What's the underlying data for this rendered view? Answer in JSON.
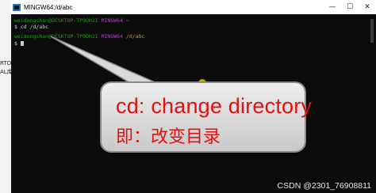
{
  "background_window": {
    "text_1": "RTOS",
    "text_2": "AL库实"
  },
  "window": {
    "title": "MINGW64:/d/abc",
    "icon": "mintty-terminal-icon",
    "controls": {
      "minimize": "—",
      "maximize": "☐",
      "close": "✕"
    }
  },
  "console": {
    "prompt1": {
      "user": "weidongshan@DESKTOP-TP9DH2I",
      "system": "MINGW64",
      "path": "~"
    },
    "command": "$ cd /d/abc",
    "prompt2": {
      "user": "weidongshan@DESKTOP-TP9DH2I",
      "system": "MINGW64",
      "path": "/d/abc"
    },
    "current_prompt": "$"
  },
  "callout": {
    "line1": "cd: change  directory",
    "line2": "即：改变目录",
    "text_color": "#e21010"
  },
  "watermark": "CSDN @2301_76908811",
  "colors": {
    "terminal_bg": "#0c0c0c",
    "user": "#13a10e",
    "system": "#b148c6",
    "path": "#c19c00"
  }
}
